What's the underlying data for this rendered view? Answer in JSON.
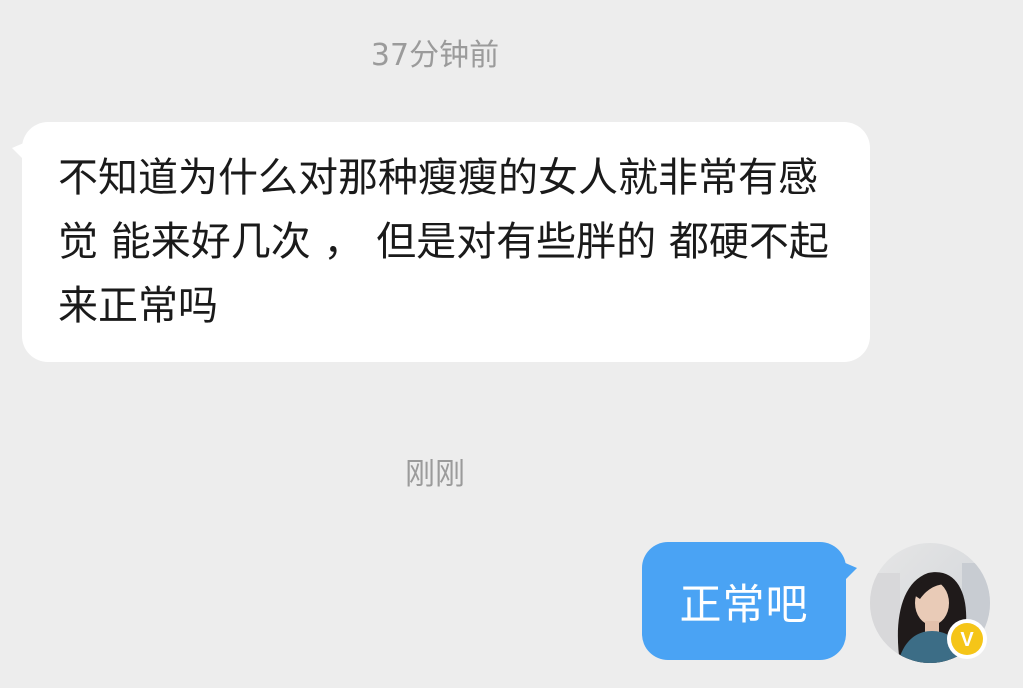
{
  "chat": {
    "timestamps": [
      "37分钟前",
      "刚刚"
    ],
    "messages": [
      {
        "direction": "incoming",
        "text": "不知道为什么对那种瘦瘦的女人就非常有感觉 能来好几次 ， 但是对有些胖的 都硬不起来正常吗"
      },
      {
        "direction": "outgoing",
        "text": "正常吧"
      }
    ],
    "avatar": {
      "icon": "user-avatar-photo",
      "badge_icon": "verified-v-badge-icon",
      "badge_letter": "V"
    }
  },
  "colors": {
    "background": "#ededed",
    "incoming_bubble": "#ffffff",
    "outgoing_bubble": "#4aa3f4",
    "timestamp_text": "#9b9b9b",
    "badge": "#f5c518"
  }
}
